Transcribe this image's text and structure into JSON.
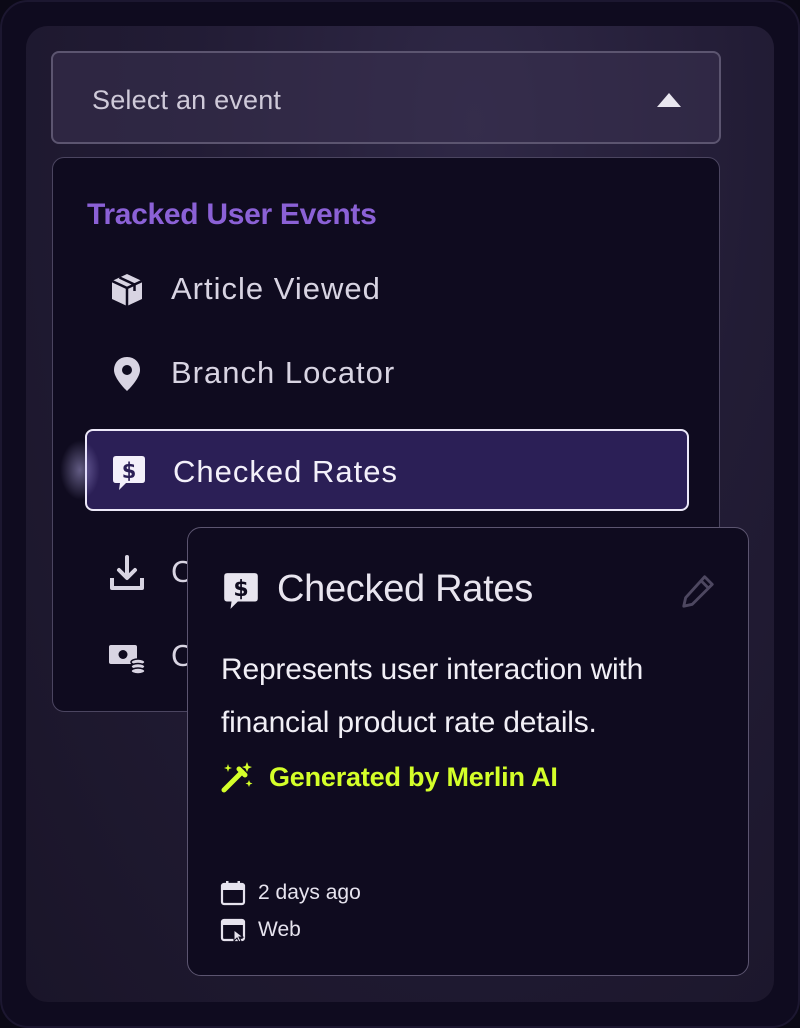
{
  "select": {
    "placeholder": "Select an event",
    "caret_icon": "caret-up-icon"
  },
  "menu": {
    "group_title": "Tracked User Events",
    "items": [
      {
        "label": "Article Viewed",
        "icon": "box-icon",
        "selected": false
      },
      {
        "label": "Branch Locator",
        "icon": "map-pin-icon",
        "selected": false
      },
      {
        "label": "Checked Rates",
        "icon": "dollar-chat-icon",
        "selected": true
      },
      {
        "label": "C",
        "icon": "download-icon",
        "selected": false
      },
      {
        "label": "C",
        "icon": "cash-coins-icon",
        "selected": false
      }
    ]
  },
  "card": {
    "title": "Checked Rates",
    "icon": "dollar-chat-icon",
    "edit_icon": "pencil-icon",
    "description": "Represents user interaction with financial product rate details.",
    "generated": {
      "icon": "magic-wand-icon",
      "label": "Generated by Merlin AI"
    },
    "meta": [
      {
        "icon": "calendar-icon",
        "text": "2 days ago"
      },
      {
        "icon": "browser-window-icon",
        "text": "Web"
      }
    ]
  },
  "colors": {
    "background": "#0f0b1f",
    "panel": "#221c35",
    "accent_purple": "#8b61d6",
    "selected_bg": "#2b1f56",
    "ai_green": "#d4ff29",
    "text_primary": "#e8e5ef"
  }
}
